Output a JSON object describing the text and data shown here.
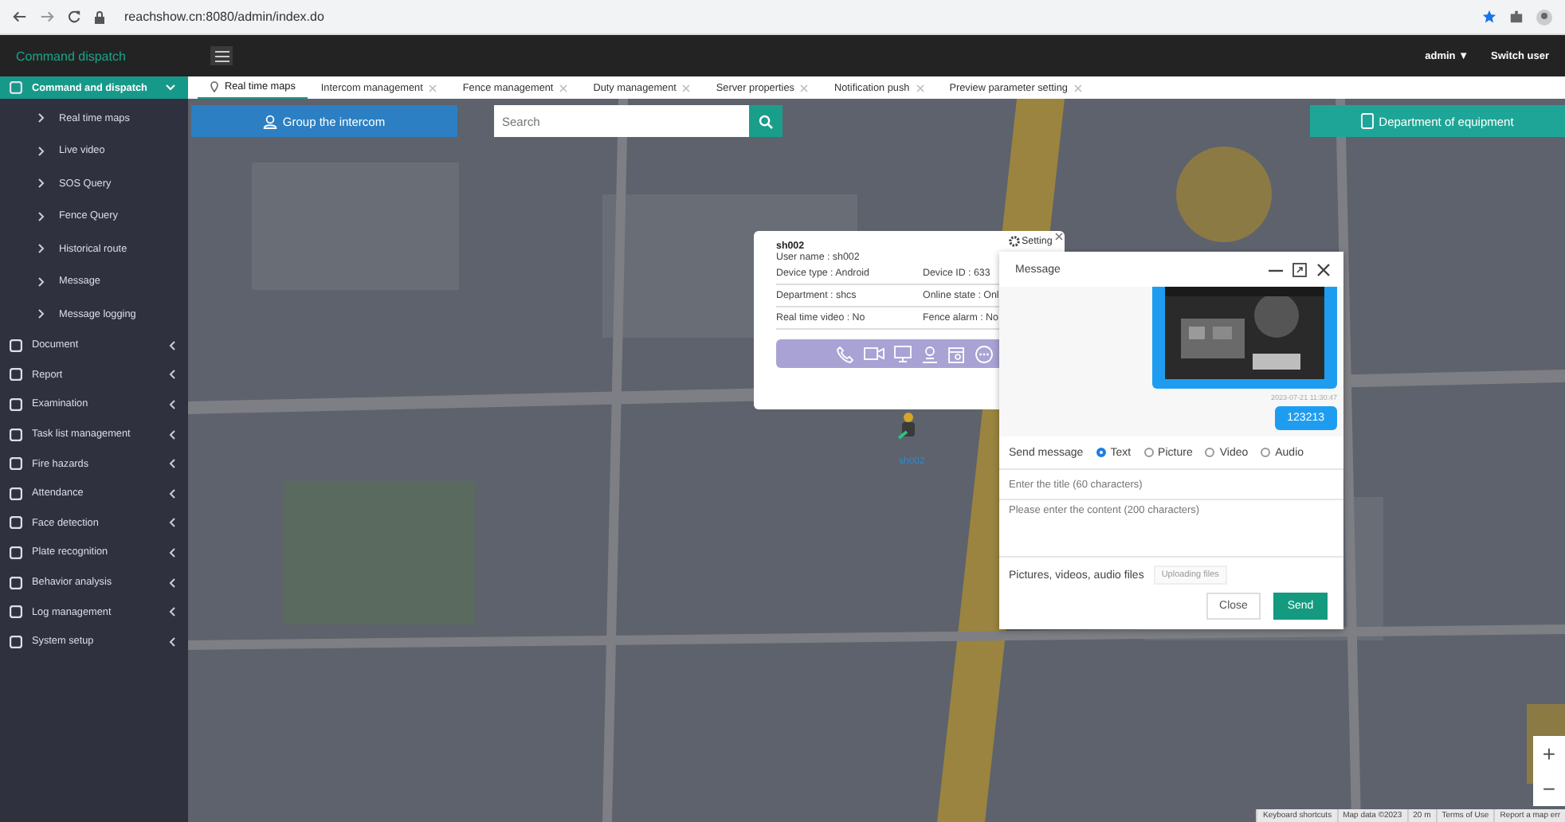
{
  "browser": {
    "url": "reachshow.cn:8080/admin/index.do"
  },
  "header": {
    "app_title": "Command dispatch",
    "user": "admin",
    "user_caret": "▼",
    "switch_user": "Switch user"
  },
  "sidebar": {
    "items": [
      {
        "label": "Command and dispatch",
        "expanded": true,
        "selected": true,
        "children": [
          {
            "label": "Real time maps"
          },
          {
            "label": "Live video"
          },
          {
            "label": "SOS Query"
          },
          {
            "label": "Fence Query"
          },
          {
            "label": "Historical route"
          },
          {
            "label": "Message"
          },
          {
            "label": "Message logging"
          }
        ]
      },
      {
        "label": "Document",
        "expanded": false,
        "selected": false
      },
      {
        "label": "Report",
        "expanded": false,
        "selected": false
      },
      {
        "label": "Examination",
        "expanded": false,
        "selected": false
      },
      {
        "label": "Task list management",
        "expanded": false,
        "selected": false
      },
      {
        "label": "Fire hazards",
        "expanded": false,
        "selected": false
      },
      {
        "label": "Attendance",
        "expanded": false,
        "selected": false
      },
      {
        "label": "Face detection",
        "expanded": false,
        "selected": false
      },
      {
        "label": "Plate recognition",
        "expanded": false,
        "selected": false
      },
      {
        "label": "Behavior analysis",
        "expanded": false,
        "selected": false
      },
      {
        "label": "Log management",
        "expanded": false,
        "selected": false
      },
      {
        "label": "System setup",
        "expanded": false,
        "selected": false
      }
    ]
  },
  "tabs": [
    {
      "label": "Real time maps",
      "selected": true
    },
    {
      "label": "Intercom management",
      "selected": false
    },
    {
      "label": "Fence management",
      "selected": false
    },
    {
      "label": "Duty management",
      "selected": false
    },
    {
      "label": "Server properties",
      "selected": false
    },
    {
      "label": "Notification push",
      "selected": false
    },
    {
      "label": "Preview parameter setting",
      "selected": false
    }
  ],
  "map": {
    "kind": "picture",
    "group_button": "Group the intercom",
    "search": {
      "placeholder": "Search"
    },
    "department_button": "Department of equipment",
    "marker_label": "sh002",
    "zoom_in": "+",
    "zoom_out": "−",
    "attribution": [
      "Keyboard shortcuts",
      "Map data ©2023",
      "20 m",
      "Terms of Use",
      "Report a map err"
    ]
  },
  "device_popup": {
    "name": "sh002",
    "user_name": "User name : sh002",
    "rows": [
      [
        "Device type : Android",
        "Device ID : 633"
      ],
      [
        "Department : shcs",
        "Online state : Onl"
      ],
      [
        "Real time video : No",
        "Fence alarm : No"
      ]
    ],
    "setting": "Setting"
  },
  "message_dialog": {
    "title": "Message",
    "messages": [
      {
        "kind": "picture"
      },
      {
        "kind": "time",
        "text": "2023-07-21 11:30:47"
      },
      {
        "kind": "text",
        "text": "123213"
      }
    ],
    "send_label": "Send message",
    "types": [
      {
        "label": "Text",
        "selected": true
      },
      {
        "label": "Picture",
        "selected": false
      },
      {
        "label": "Video",
        "selected": false
      },
      {
        "label": "Audio",
        "selected": false
      }
    ],
    "title_field": {
      "placeholder": "Enter the title (60 characters)"
    },
    "content_field": {
      "placeholder": "Please enter the content (200 characters)"
    },
    "files_label": "Pictures, videos, audio files",
    "upload_button": "Uploading files",
    "close_button": "Close",
    "send_button": "Send"
  }
}
